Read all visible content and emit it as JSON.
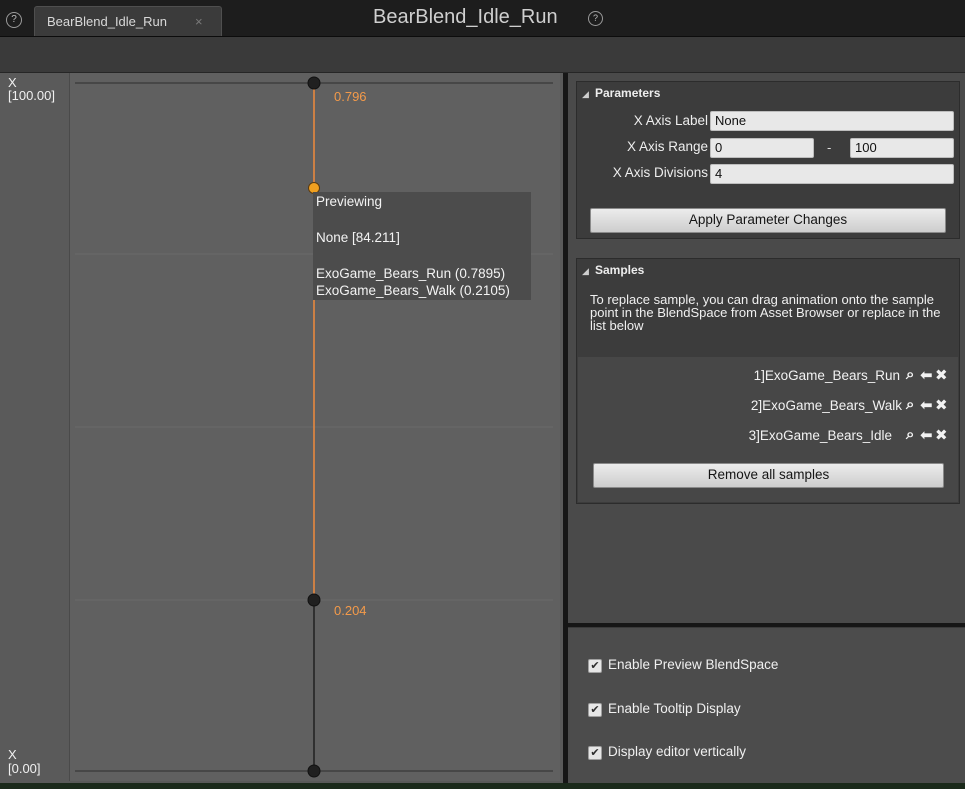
{
  "tab": {
    "help_icon": "?",
    "label": "BearBlend_Idle_Run",
    "close_icon": "×"
  },
  "title": {
    "text": "BearBlend_Idle_Run",
    "help_icon": "?"
  },
  "graph": {
    "axis_top_name": "X",
    "axis_top_value": "[100.00]",
    "axis_bottom_name": "X",
    "axis_bottom_value": "[0.00]",
    "sample_weight_top": "0.796",
    "sample_weight_bottom": "0.204",
    "line_color": "#f08a3c",
    "tooltip": {
      "title": "Previewing",
      "position": "None [84.211]",
      "entries": [
        "ExoGame_Bears_Run (0.7895)",
        "ExoGame_Bears_Walk (0.2105)"
      ]
    }
  },
  "parameters": {
    "header": "Parameters",
    "x_axis_label_label": "X Axis Label",
    "x_axis_label_value": "None",
    "x_axis_range_label": "X Axis Range",
    "x_axis_range_min": "0",
    "x_axis_range_sep": "-",
    "x_axis_range_max": "100",
    "x_axis_divisions_label": "X Axis Divisions",
    "x_axis_divisions_value": "4",
    "apply_button": "Apply Parameter Changes"
  },
  "samples": {
    "header": "Samples",
    "description": "To replace sample, you can drag animation onto the sample point in the BlendSpace from Asset Browser or replace in the list below",
    "items": [
      {
        "label": "1]ExoGame_Bears_Run"
      },
      {
        "label": "2]ExoGame_Bears_Walk"
      },
      {
        "label": "3]ExoGame_Bears_Idle"
      }
    ],
    "item_icons": {
      "browse": "⌕",
      "use": "⬅",
      "remove": "✖"
    },
    "remove_all_button": "Remove all samples"
  },
  "options": [
    {
      "label": "Enable Preview BlendSpace",
      "checked": true
    },
    {
      "label": "Enable Tooltip Display",
      "checked": true
    },
    {
      "label": "Display editor vertically",
      "checked": true
    }
  ]
}
